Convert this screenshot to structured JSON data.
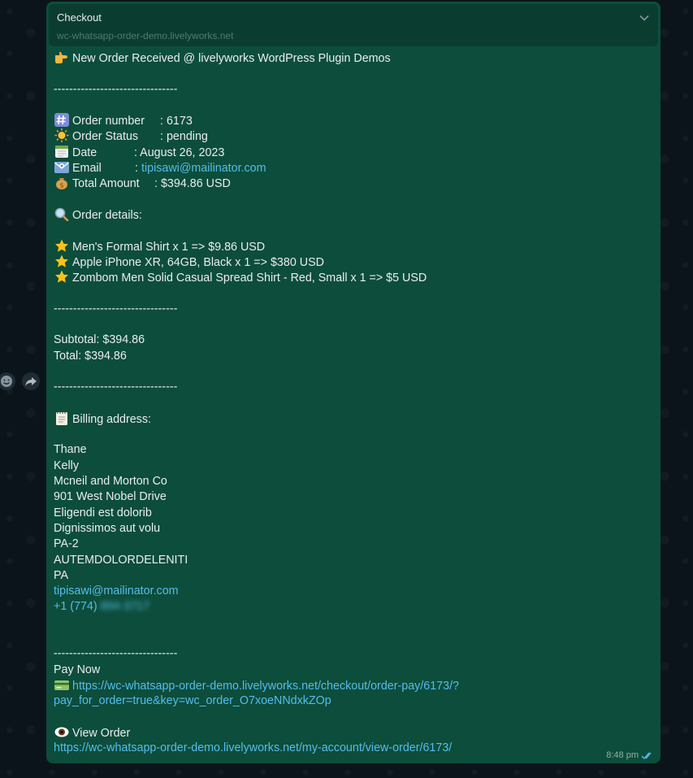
{
  "preview": {
    "title": "Checkout",
    "domain": "wc-whatsapp-order-demo.livelyworks.net"
  },
  "message": {
    "header": "New Order Received @ livelyworks WordPress Plugin Demos",
    "divider": "--------------------------------",
    "order_number": {
      "label": "Order number",
      "sep": ":",
      "value": "6173"
    },
    "order_status": {
      "label": "Order Status",
      "sep": ":",
      "value": "pending"
    },
    "date": {
      "label": "Date",
      "sep": ":",
      "value": "August 26, 2023"
    },
    "email": {
      "label": "Email",
      "sep": ":",
      "value": "tipisawi@mailinator.com"
    },
    "total_amount": {
      "label": "Total Amount",
      "sep": ":",
      "value": "$394.86 USD"
    },
    "order_details_title": "Order details:",
    "items": [
      "Men's Formal Shirt x 1 => $9.86 USD",
      "Apple iPhone XR, 64GB, Black x 1 => $380 USD",
      "Zombom Men Solid Casual Spread Shirt - Red, Small x 1 => $5 USD"
    ],
    "subtotal": "Subtotal: $394.86",
    "total": "Total: $394.86",
    "billing_title": "Billing address:",
    "billing": {
      "first_name": "Thane",
      "last_name": "Kelly",
      "company": "Mcneil and Morton Co",
      "address1": "901 West Nobel Drive",
      "address2": "Eligendi est dolorib",
      "city": "Dignissimos aut volu",
      "state_code": "PA-2",
      "postcode": "AUTEMDOLORDELENITI",
      "country": "PA",
      "email": "tipisawi@mailinator.com",
      "phone_prefix": "+1 (774)",
      "phone_hidden": "894-3717"
    },
    "pay_now_label": "Pay Now",
    "pay_link_line1": "https://wc-whatsapp-order-demo.livelyworks.net/checkout/order-pay/6173/?",
    "pay_link_line2": "pay_for_order=true&key=wc_order_O7xoeNNdxkZOp",
    "view_order_label": "View Order",
    "view_order_link": "https://wc-whatsapp-order-demo.livelyworks.net/my-account/view-order/6173/",
    "time": "8:48 pm"
  },
  "icons": {
    "header": "pointing-hand-icon",
    "order_number": "keycap-hash-icon",
    "order_status": "sun-icon",
    "date": "calendar-icon",
    "email": "envelope-icon",
    "total_amount": "money-bag-icon",
    "order_details": "magnifier-icon",
    "item": "star-icon",
    "billing": "notepad-icon",
    "pay": "credit-card-icon",
    "view": "eye-icon",
    "read_receipt": "double-check-icon",
    "side_emoji": "emoji-icon",
    "side_forward": "forward-icon"
  },
  "colors": {
    "bubble": "#0d4d3b",
    "preview": "#0a3d30",
    "link": "#53bdeb",
    "background": "#0b141a"
  }
}
